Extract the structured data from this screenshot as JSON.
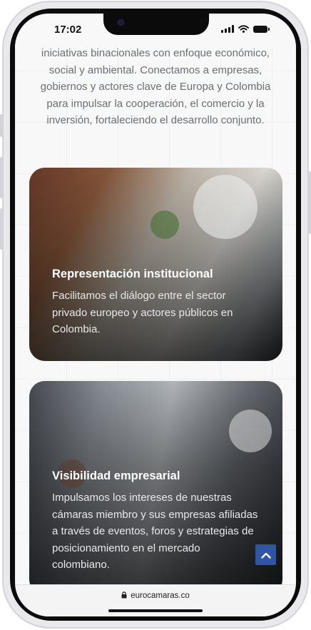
{
  "status_bar": {
    "time": "17:02"
  },
  "intro": {
    "text": "iniciativas binacionales con enfoque económico, social y ambiental. Conectamos a empresas, gobiernos y actores clave de Europa y Colombia para impulsar la cooperación, el comercio y la inversión, fortaleciendo el desarrollo conjunto."
  },
  "cards": [
    {
      "title": "Representación institucional",
      "text": "Facilitamos el diálogo entre el sector privado europeo y actores públicos en Colombia."
    },
    {
      "title": "Visibilidad empresarial",
      "text": "Impulsamos los intereses de nuestras cámaras miembro y sus empresas afiliadas a través de eventos, foros y estrategias de posicionamiento en el mercado colombiano."
    }
  ],
  "browser": {
    "url": "eurocamaras.co"
  },
  "colors": {
    "accent": "#2f55a4",
    "text_muted": "#6b6e73"
  },
  "icons": [
    "wifi-icon",
    "signal-icon",
    "battery-icon",
    "lock-icon",
    "chevron-up-icon"
  ]
}
